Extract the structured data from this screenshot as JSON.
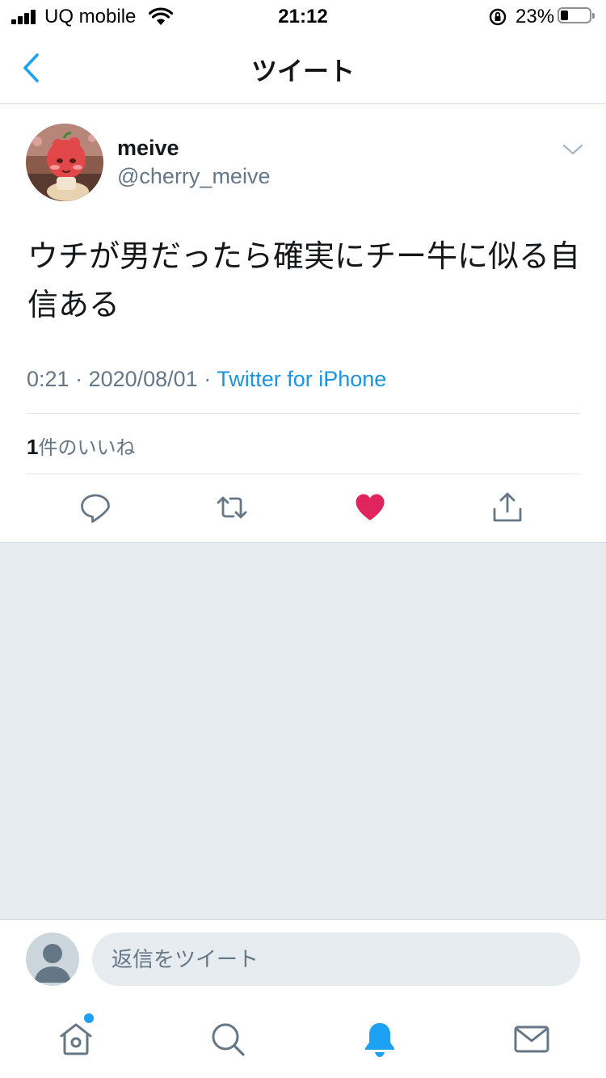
{
  "status_bar": {
    "carrier": "UQ mobile",
    "time": "21:12",
    "battery_percent": "23%"
  },
  "nav": {
    "title": "ツイート"
  },
  "tweet": {
    "display_name": "meive",
    "handle": "@cherry_meive",
    "text": "ウチが男だったら確実にチー牛に似る自信ある",
    "time": "0:21",
    "separator": " · ",
    "date": "2020/08/01",
    "source": "Twitter for iPhone",
    "like_count": "1",
    "like_label": "件のいいね",
    "liked": true
  },
  "reply": {
    "placeholder": "返信をツイート"
  },
  "icons": {
    "back": "chevron-left-icon",
    "more": "chevron-down-icon",
    "reply": "reply-bubble-icon",
    "retweet": "retweet-icon",
    "like": "heart-icon",
    "share": "share-icon",
    "home": "home-icon",
    "search": "search-icon",
    "notifications": "bell-icon",
    "messages": "envelope-icon"
  },
  "colors": {
    "accent": "#1da1f2",
    "link": "#1b95e0",
    "like": "#e0245e",
    "secondary_text": "#657786",
    "background_grey": "#e6ecf0"
  }
}
